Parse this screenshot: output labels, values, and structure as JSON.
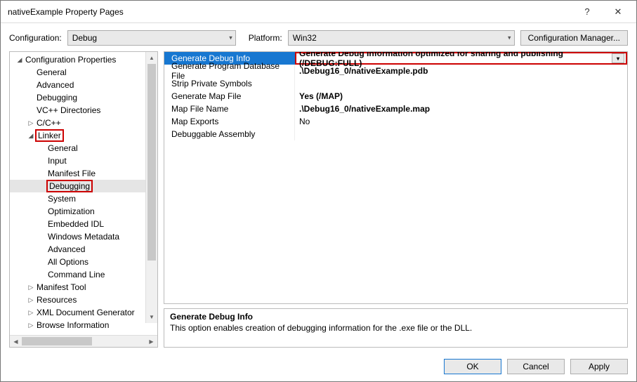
{
  "window": {
    "title": "nativeExample Property Pages"
  },
  "toolbar": {
    "configuration_label": "Configuration:",
    "configuration_value": "Debug",
    "platform_label": "Platform:",
    "platform_value": "Win32",
    "config_manager_label": "Configuration Manager..."
  },
  "tree": {
    "root": "Configuration Properties",
    "general": "General",
    "advanced": "Advanced",
    "debugging": "Debugging",
    "vcpp": "VC++ Directories",
    "cpp": "C/C++",
    "linker": "Linker",
    "linker_children": {
      "general": "General",
      "input": "Input",
      "manifest": "Manifest File",
      "debugging": "Debugging",
      "system": "System",
      "optimization": "Optimization",
      "embedded_idl": "Embedded IDL",
      "win_meta": "Windows Metadata",
      "advanced": "Advanced",
      "all_options": "All Options",
      "cmdline": "Command Line"
    },
    "manifest_tool": "Manifest Tool",
    "resources": "Resources",
    "xml_doc": "XML Document Generator",
    "browse_info": "Browse Information"
  },
  "grid": {
    "rows": [
      {
        "name": "Generate Debug Info",
        "value": "Generate Debug Information optimized for sharing and publishing (/DEBUG:FULL)",
        "selected": true,
        "bold": true
      },
      {
        "name": "Generate Program Database File",
        "value": ".\\Debug16_0/nativeExample.pdb",
        "bold": true
      },
      {
        "name": "Strip Private Symbols",
        "value": ""
      },
      {
        "name": "Generate Map File",
        "value": "Yes (/MAP)",
        "bold": true
      },
      {
        "name": "Map File Name",
        "value": ".\\Debug16_0/nativeExample.map",
        "bold": true
      },
      {
        "name": "Map Exports",
        "value": "No"
      },
      {
        "name": "Debuggable Assembly",
        "value": ""
      }
    ]
  },
  "description": {
    "title": "Generate Debug Info",
    "text": "This option enables creation of debugging information for the .exe file or the DLL."
  },
  "buttons": {
    "ok": "OK",
    "cancel": "Cancel",
    "apply": "Apply"
  }
}
